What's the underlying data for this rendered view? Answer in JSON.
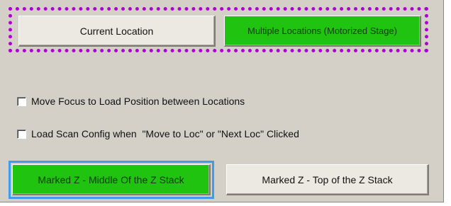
{
  "location_mode": {
    "current_label": "Current Location",
    "multiple_label": "Multiple Locations (Motorized Stage)",
    "selected": "Multiple Locations (Motorized Stage)"
  },
  "options": {
    "move_focus_label": "Move Focus to Load Position between Locations",
    "move_focus_checked": false,
    "load_scan_label": "Load Scan Config when  \"Move to Loc\" or \"Next Loc\" Clicked",
    "load_scan_checked": false
  },
  "marked_z": {
    "middle_label": "Marked Z - Middle Of the Z Stack",
    "top_label": "Marked Z - Top of the Z Stack",
    "selected": "Marked Z - Middle Of the Z Stack"
  },
  "colors": {
    "active_button": "#20c410",
    "group_outline": "#b000d8",
    "focus_ring": "#3d9cf0",
    "panel_background": "#d4d0c8"
  }
}
